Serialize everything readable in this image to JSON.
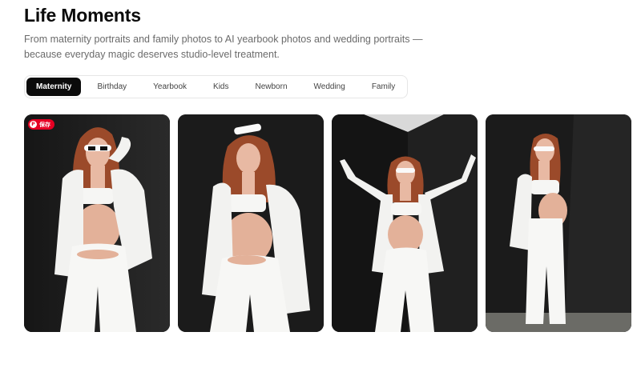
{
  "header": {
    "title": "Life Moments",
    "subtitle": "From maternity portraits and family photos to AI yearbook photos and wedding portraits — because everyday magic deserves studio-level treatment."
  },
  "tabs": [
    {
      "label": "Maternity",
      "active": true
    },
    {
      "label": "Birthday",
      "active": false
    },
    {
      "label": "Yearbook",
      "active": false
    },
    {
      "label": "Kids",
      "active": false
    },
    {
      "label": "Newborn",
      "active": false
    },
    {
      "label": "Wedding",
      "active": false
    },
    {
      "label": "Family",
      "active": false
    }
  ],
  "gallery": {
    "save_badge": "保存",
    "images": [
      {
        "label": "maternity-photo-1"
      },
      {
        "label": "maternity-photo-2"
      },
      {
        "label": "maternity-photo-3"
      },
      {
        "label": "maternity-photo-4"
      }
    ]
  },
  "colors": {
    "accent": "#0b0b0b",
    "pinterest_red": "#e60023",
    "hair": "#9b4a2a",
    "suit": "#f4f4f2",
    "skin": "#e8b9a3",
    "backdrop": "#1c1c1c"
  }
}
